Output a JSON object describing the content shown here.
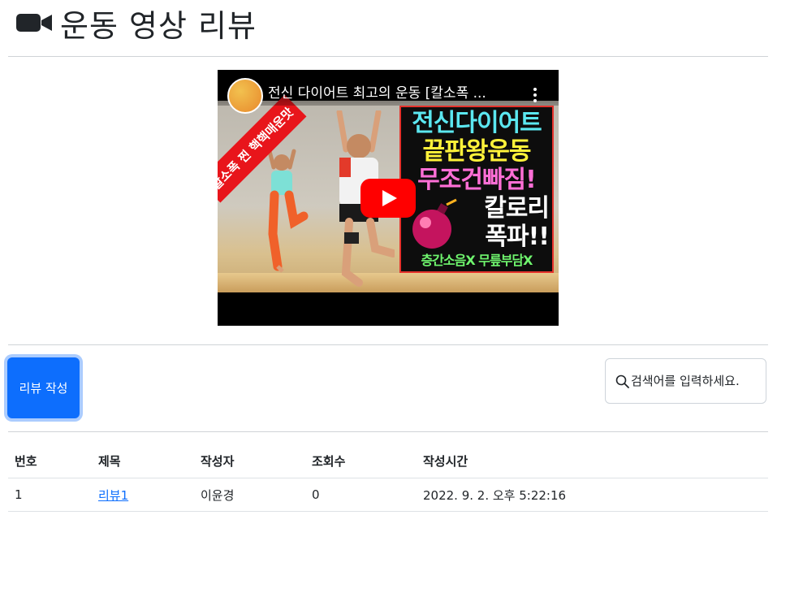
{
  "header": {
    "title": "운동 영상 리뷰",
    "icon": "video-camera-icon"
  },
  "video": {
    "title": "전신 다이어트 최고의 운동 [칼소폭 ...",
    "ribbon_text": "칼소폭 찐 핵핵매운맛",
    "thumbnail_text": [
      "전신다이어트",
      "끝판왕운동",
      "무조건빠짐!",
      "칼로리",
      "폭파!!",
      "층간소음X 무릎부담X"
    ],
    "play_icon": "youtube-play-icon",
    "colors": {
      "play": "#ff0000",
      "ribbon": "#e8151b"
    }
  },
  "actions": {
    "write_label": "리뷰 작성",
    "search_placeholder": "검색어를 입력하세요."
  },
  "table": {
    "headers": [
      "번호",
      "제목",
      "작성자",
      "조회수",
      "작성시간"
    ],
    "rows": [
      {
        "num": "1",
        "title": "리뷰1",
        "author": "이윤경",
        "views": "0",
        "time": "2022. 9. 2. 오후 5:22:16"
      }
    ]
  },
  "colors": {
    "primary": "#0d6efd",
    "divider": "#dee2e6"
  }
}
